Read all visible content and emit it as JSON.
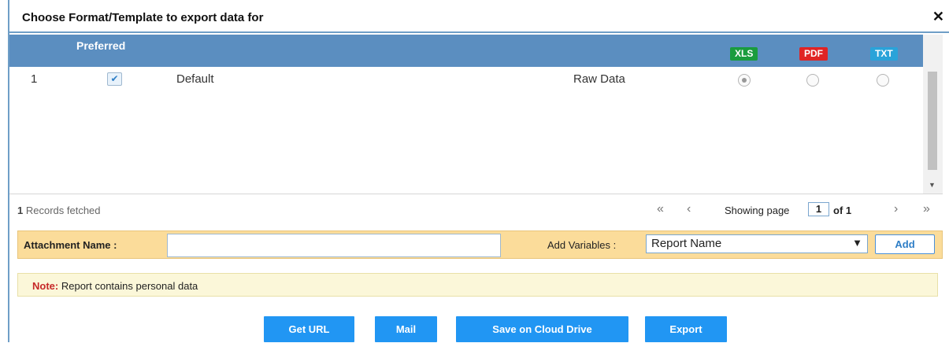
{
  "dialog": {
    "title": "Choose Format/Template to export data for",
    "close_label": "✕"
  },
  "grid": {
    "header_preferred": "Preferred",
    "formats": [
      {
        "label": "XLS",
        "color": "#1a9c3e"
      },
      {
        "label": "PDF",
        "color": "#e02424"
      },
      {
        "label": "TXT",
        "color": "#2aa3d9"
      }
    ],
    "rows": [
      {
        "index": "1",
        "preferred": true,
        "name": "Default",
        "template": "Raw Data",
        "selected_format": "XLS"
      }
    ]
  },
  "footer": {
    "records_count": "1",
    "records_text": "Records fetched",
    "showing_label": "Showing page",
    "page_value": "1",
    "of_label": "of 1"
  },
  "attachment": {
    "label": "Attachment Name :",
    "value": "",
    "add_variables_label": "Add Variables :",
    "selected_variable": "Report Name",
    "add_button": "Add"
  },
  "note": {
    "label": "Note:",
    "text": "Report contains personal data"
  },
  "actions": {
    "get_url": "Get URL",
    "mail": "Mail",
    "save_cloud": "Save on Cloud Drive",
    "export": "Export"
  }
}
